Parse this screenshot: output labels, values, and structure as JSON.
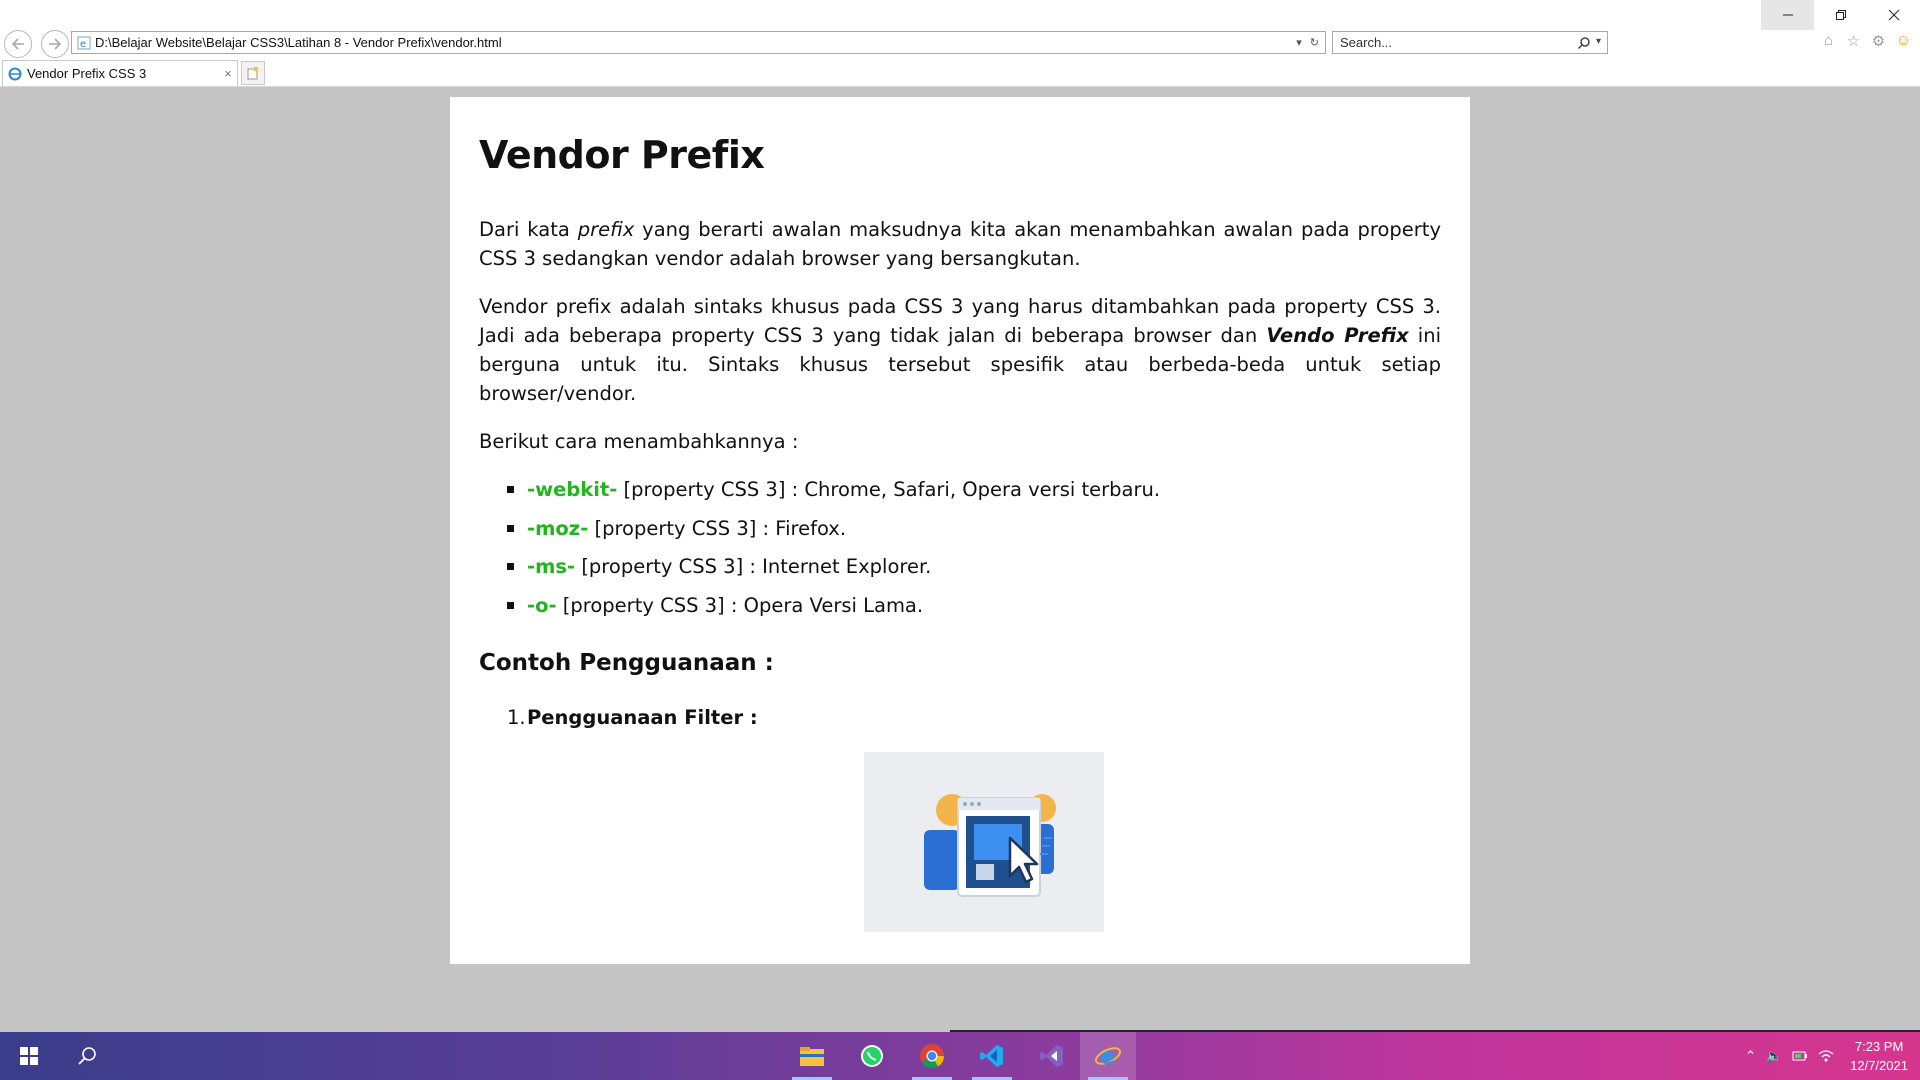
{
  "browser": {
    "address_url": "D:\\Belajar Website\\Belajar CSS3\\Latihan 8 - Vendor Prefix\\vendor.html",
    "search_placeholder": "Search...",
    "tab_title": "Vendor Prefix CSS 3"
  },
  "page": {
    "title": "Vendor Prefix",
    "para1": {
      "before": "Dari kata ",
      "em": "prefix",
      "after": " yang berarti awalan maksudnya kita akan menambahkan awalan pada property CSS 3 sedangkan vendor adalah browser yang bersangkutan."
    },
    "para2": {
      "before": "Vendor prefix adalah sintaks khusus pada CSS 3 yang harus ditambahkan pada property CSS 3. Jadi ada beberapa property CSS 3 yang tidak jalan di beberapa browser dan ",
      "strong_em": "Vendo Prefix",
      "after": " ini berguna untuk itu. Sintaks khusus tersebut spesifik atau berbeda-beda untuk setiap browser/vendor."
    },
    "para3": "Berikut cara menambahkannya :",
    "prefix_list": [
      {
        "prefix": "-webkit-",
        "text": " [property CSS 3] : Chrome, Safari, Opera versi terbaru."
      },
      {
        "prefix": "-moz-",
        "text": " [property CSS 3] : Firefox."
      },
      {
        "prefix": "-ms-",
        "text": " [property CSS 3] : Internet Explorer."
      },
      {
        "prefix": "-o-",
        "text": " [property CSS 3] : Opera Versi Lama."
      }
    ],
    "subheading": "Contoh Pengguanaan :",
    "ordered": [
      {
        "num": "1.",
        "text": "Pengguanaan Filter :"
      }
    ]
  },
  "taskbar": {
    "time": "7:23 PM",
    "date": "12/7/2021",
    "apps": [
      "file-explorer",
      "whatsapp",
      "chrome",
      "vscode",
      "visual-studio",
      "internet-explorer"
    ]
  },
  "colors": {
    "prefix_green": "#22b51e",
    "page_bg": "#c4c4c4"
  }
}
